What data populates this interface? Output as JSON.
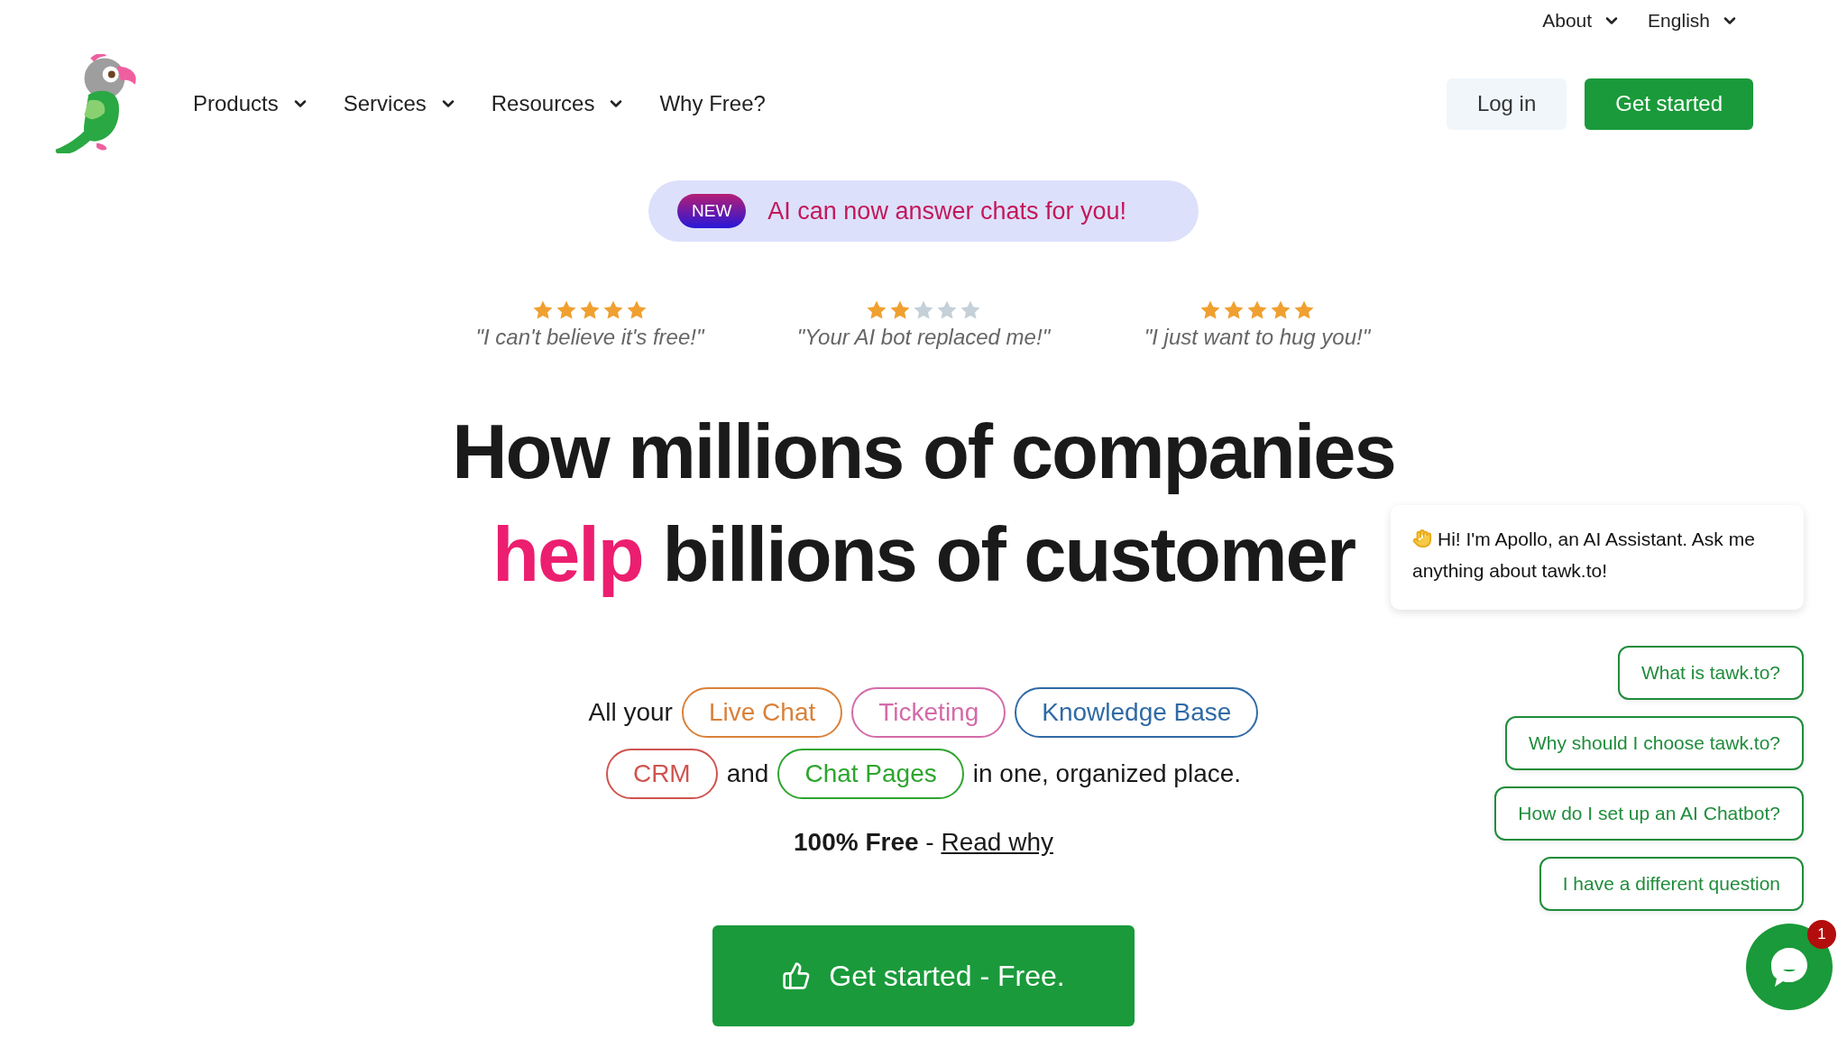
{
  "top_links": [
    {
      "label": "About",
      "has_menu": true
    },
    {
      "label": "English",
      "has_menu": true
    }
  ],
  "nav": {
    "items": [
      {
        "label": "Products",
        "has_menu": true
      },
      {
        "label": "Services",
        "has_menu": true
      },
      {
        "label": "Resources",
        "has_menu": true
      },
      {
        "label": "Why Free?",
        "has_menu": false
      }
    ],
    "buttons": [
      {
        "label": "Log in",
        "kind": "secondary"
      },
      {
        "label": "Get started",
        "kind": "primary"
      }
    ]
  },
  "announcement": {
    "badge": "NEW",
    "text": "AI can now answer chats for you!"
  },
  "reviews": [
    {
      "stars": 5,
      "quote": "\"I can't believe it's free!\""
    },
    {
      "stars": 2,
      "quote": "\"Your AI bot replaced me!\""
    },
    {
      "stars": 5,
      "quote": "\"I just want to hug you!\""
    }
  ],
  "headline": {
    "line_1": "How millions of companies",
    "highlight": "help",
    "line_2": "billions of customer"
  },
  "feature_lines": [
    [
      {
        "kind": "text",
        "text": "All your"
      },
      {
        "kind": "tag",
        "text": "Live Chat",
        "color": "#d9813a"
      },
      {
        "kind": "tag",
        "text": "Ticketing",
        "color": "#d46aa8"
      },
      {
        "kind": "tag",
        "text": "Knowledge Base",
        "color": "#2f6aa5"
      }
    ],
    [
      {
        "kind": "tag",
        "text": "CRM",
        "color": "#d0544f"
      },
      {
        "kind": "text",
        "text": "and"
      },
      {
        "kind": "tag",
        "text": "Chat Pages",
        "color": "#2ea52e"
      },
      {
        "kind": "text",
        "text": "in one, organized place."
      }
    ]
  ],
  "free_note": {
    "bold": "100% Free",
    "separator": "-",
    "link": "Read why"
  },
  "cta": {
    "label": "Get started - Free."
  },
  "chat_widget": {
    "message": "Hi! I'm Apollo, an AI Assistant. Ask me anything about tawk.to!",
    "quick_replies": [
      "What is tawk.to?",
      "Why should I choose tawk.to?",
      "How do I set up an AI Chatbot?",
      "I have a different question"
    ],
    "launcher_badge": "1"
  }
}
